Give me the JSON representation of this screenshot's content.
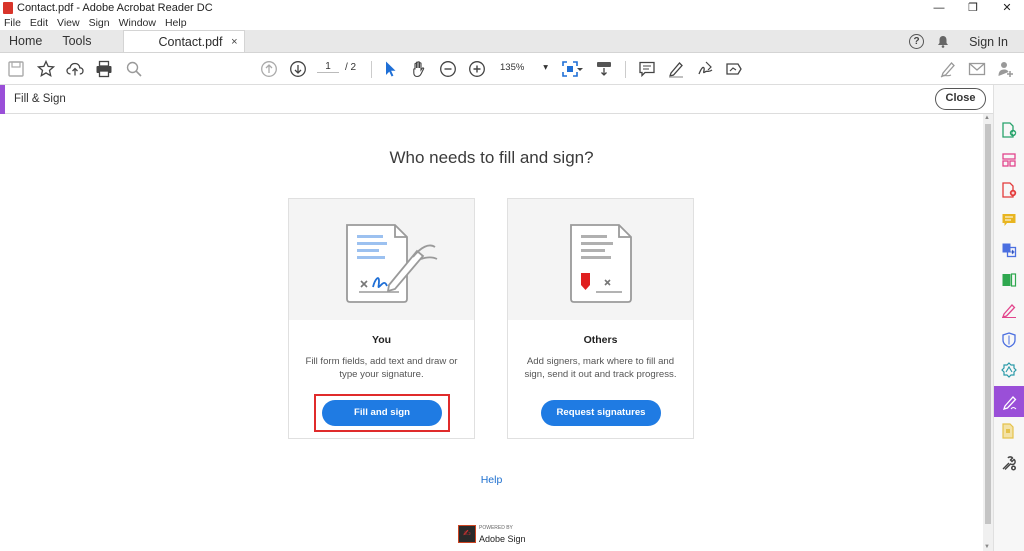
{
  "window": {
    "title": "Contact.pdf - Adobe Acrobat Reader DC",
    "controls": [
      "—",
      "❐",
      "✕"
    ]
  },
  "menu": [
    "File",
    "Edit",
    "View",
    "Sign",
    "Window",
    "Help"
  ],
  "tabs": {
    "home": "Home",
    "tools": "Tools",
    "document": "Contact.pdf",
    "close_glyph": "×",
    "help_glyph": "?",
    "sign_in": "Sign In"
  },
  "toolbar": {
    "page_current": "1",
    "page_total": "/  2",
    "zoom": "135%",
    "zoom_arrow": "▾"
  },
  "panel": {
    "title": "Fill & Sign",
    "close_label": "Close"
  },
  "main": {
    "heading": "Who needs to fill and sign?",
    "cards": [
      {
        "title": "You",
        "description": "Fill form fields, add text and draw or type your signature.",
        "button": "Fill and sign"
      },
      {
        "title": "Others",
        "description": "Add signers, mark where to fill and sign, send it out and track progress.",
        "button": "Request signatures"
      }
    ],
    "help_link": "Help",
    "powered_by": "POWERED BY",
    "adobe_sign": "Adobe Sign"
  },
  "colors": {
    "accent": "#9a4fd8",
    "primary_button": "#1f7be3",
    "highlight": "#e02b2b"
  },
  "icons": {
    "right_rail": [
      "export-pdf-icon",
      "organize-pages-icon",
      "create-pdf-icon",
      "comment-icon",
      "combine-files-icon",
      "edit-pdf-icon",
      "fill-sign-icon",
      "protect-icon",
      "sign-icon",
      "fill-sign-active-icon",
      "more-tools-icon",
      "customize-icon"
    ]
  }
}
